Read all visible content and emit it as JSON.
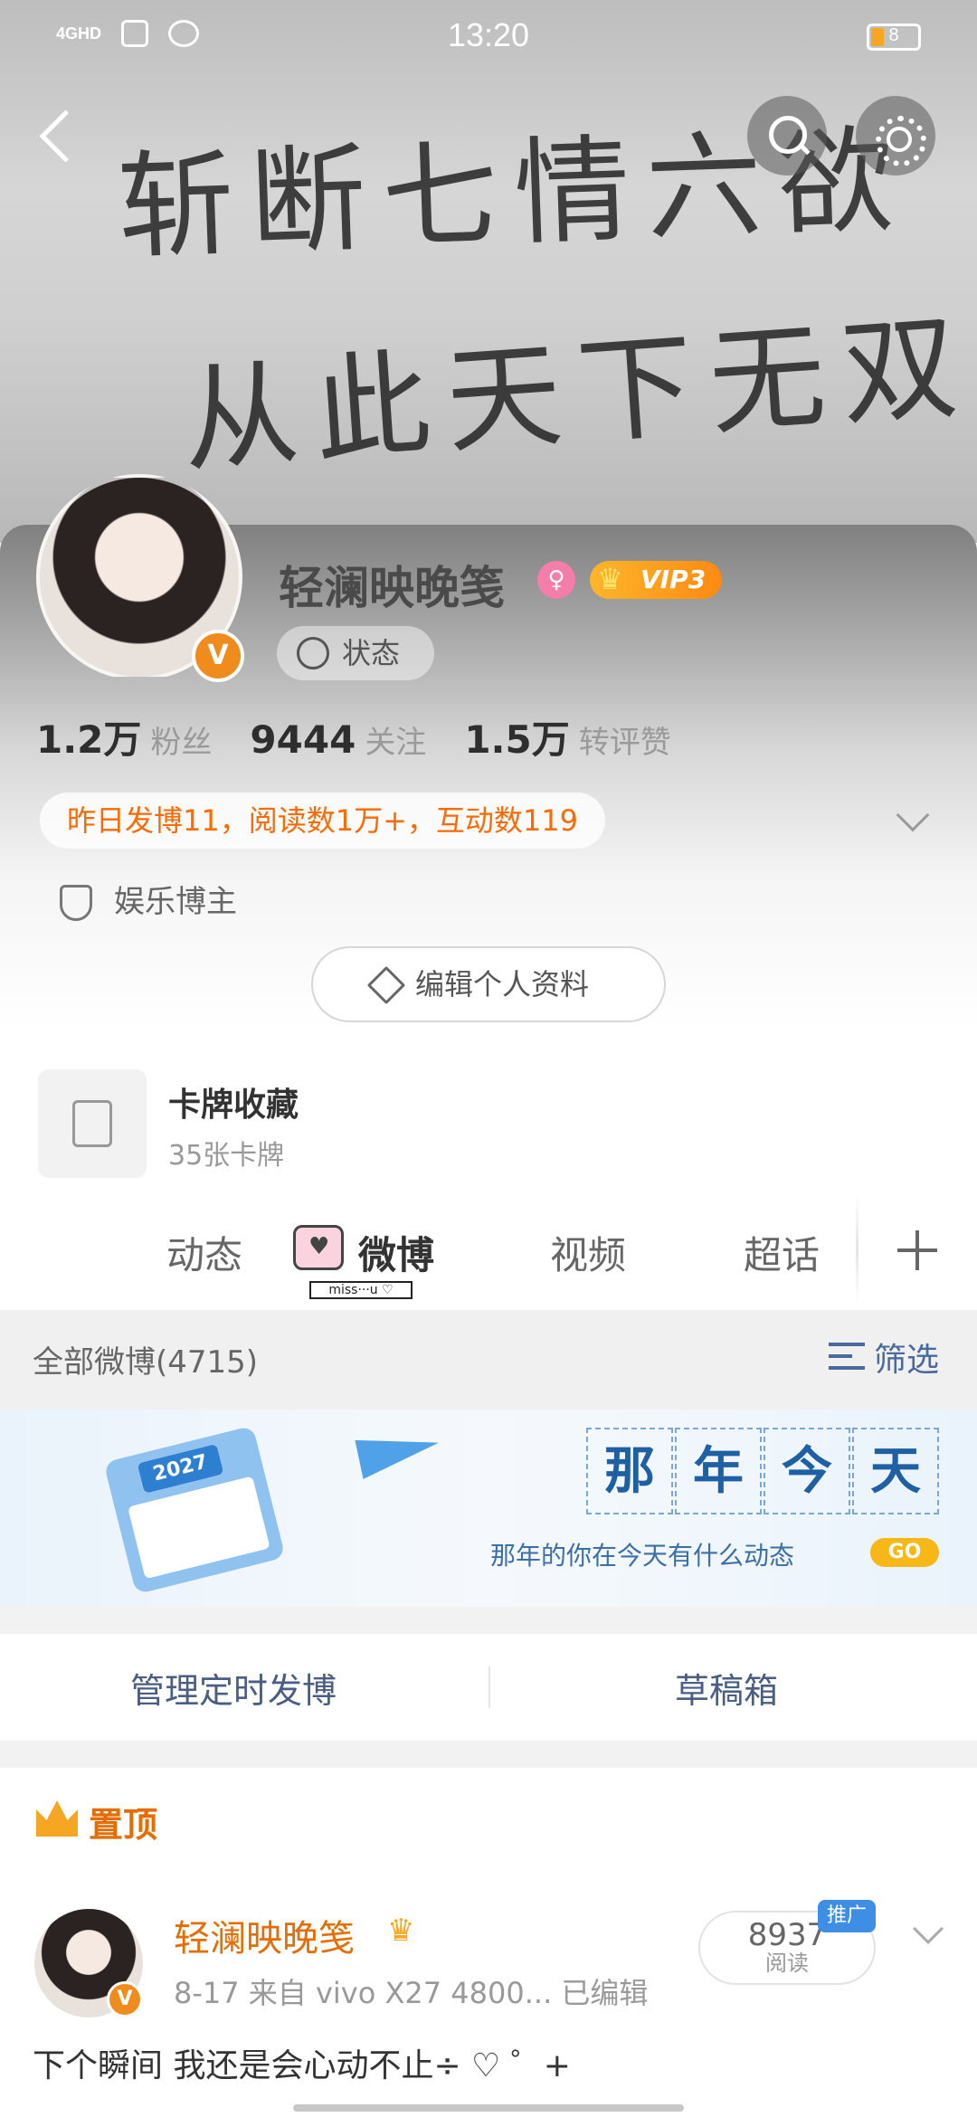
{
  "status_bar": {
    "time": "13:20",
    "network": "4GHD",
    "battery": "8"
  },
  "banner": {
    "line1": "斩断七情六欲",
    "line2": "从此天下无双"
  },
  "profile": {
    "nickname": "轻澜映晚笺",
    "vip_label": "VIP3",
    "status_label": "状态",
    "verify_mark": "V",
    "stats": [
      {
        "value": "1.2万",
        "label": "粉丝"
      },
      {
        "value": "9444",
        "label": "关注"
      },
      {
        "value": "1.5万",
        "label": "转评赞"
      }
    ],
    "summary": "昨日发博11，阅读数1万+，互动数119",
    "tag": "娱乐博主",
    "edit_label": "编辑个人资料"
  },
  "cards": {
    "title": "卡牌收藏",
    "subtitle": "35张卡牌"
  },
  "tabs": {
    "items": [
      "动态",
      "微博",
      "视频",
      "超话"
    ],
    "active": "微博",
    "deco_text": "miss···u ♡"
  },
  "filter": {
    "all_label": "全部微博(4715)",
    "filter_label": "筛选"
  },
  "memory": {
    "year": "2027",
    "title_chars": [
      "那",
      "年",
      "今",
      "天"
    ],
    "subtitle": "那年的你在今天有什么动态",
    "go_label": "GO"
  },
  "manage": {
    "scheduled": "管理定时发博",
    "drafts": "草稿箱"
  },
  "post": {
    "pin_label": "置顶",
    "author": "轻澜映晚笺",
    "meta": "8-17  来自 vivo X27 4800...  已编辑",
    "read_count": "8937",
    "read_label": "阅读",
    "promo": "推广",
    "text": "下个瞬间 我还是会心动不止÷ ♡ ゜+"
  },
  "colors": {
    "accent_orange": "#e46d00",
    "link_blue": "#4a6a9e",
    "vip_gold": "#ff8a12"
  }
}
